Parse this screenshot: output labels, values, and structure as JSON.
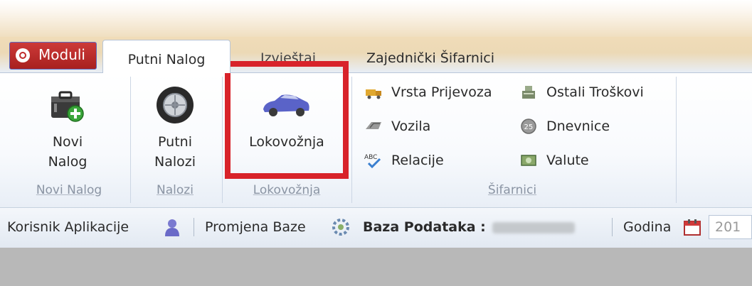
{
  "moduli": {
    "label": "Moduli"
  },
  "tabs": [
    {
      "label": "Putni Nalog"
    },
    {
      "label": "Izvještaj"
    },
    {
      "label": "Zajednički Šifarnici"
    }
  ],
  "groups": {
    "novi_nalog": {
      "button_line1": "Novi",
      "button_line2": "Nalog",
      "label": "Novi Nalog"
    },
    "nalozi": {
      "button_line1": "Putni",
      "button_line2": "Nalozi",
      "label": "Nalozi"
    },
    "lokovoznja": {
      "button_label": "Lokovožnja",
      "label": "Lokovožnja"
    },
    "sifarnici": {
      "label": "Šifarnici",
      "items": [
        {
          "label": "Vrsta Prijevoza",
          "icon": "truck-icon"
        },
        {
          "label": "Vozila",
          "icon": "train-icon"
        },
        {
          "label": "Relacije",
          "icon": "spellcheck-icon"
        },
        {
          "label": "Ostali Troškovi",
          "icon": "cash-register-icon"
        },
        {
          "label": "Dnevnice",
          "icon": "coin-icon"
        },
        {
          "label": "Valute",
          "icon": "banknote-icon"
        }
      ]
    }
  },
  "statusbar": {
    "user_label": "Korisnik Aplikacije",
    "change_db_label": "Promjena Baze",
    "db_label": "Baza Podataka :",
    "year_label": "Godina",
    "year_value": "201"
  },
  "colors": {
    "highlight": "#d8232a",
    "moduli_bg": "#b52a28",
    "content_bg": "#b8b8b8"
  }
}
